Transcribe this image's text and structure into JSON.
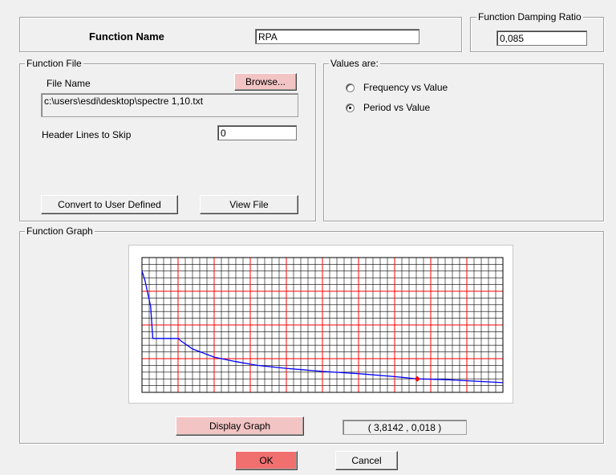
{
  "function_name": {
    "label": "Function Name",
    "value": "RPA"
  },
  "damping": {
    "legend": "Function Damping Ratio",
    "value": "0,085"
  },
  "function_file": {
    "legend": "Function File",
    "file_name_label": "File Name",
    "browse_label": "Browse...",
    "path": "c:\\users\\esdi\\desktop\\spectre 1,10.txt",
    "header_lines_label": "Header Lines to Skip",
    "header_lines_value": "0",
    "convert_label": "Convert to User Defined",
    "view_file_label": "View File"
  },
  "values_are": {
    "legend": "Values are:",
    "options": [
      {
        "label": "Frequency vs Value",
        "selected": false
      },
      {
        "label": "Period vs Value",
        "selected": true
      }
    ]
  },
  "function_graph": {
    "legend": "Function Graph",
    "display_label": "Display Graph",
    "coordinate_readout": "( 3,8142  ,  0,018 )"
  },
  "buttons": {
    "ok_label": "OK",
    "cancel_label": "Cancel"
  },
  "colors": {
    "grid_major": "#ff0000",
    "grid_minor": "#000000",
    "curve": "#0000ff",
    "marker": "#ff0000",
    "ok_button": "#f07070",
    "pink_button": "#f3c4c4"
  },
  "chart_data": {
    "type": "line",
    "title": "",
    "xlabel": "",
    "ylabel": "",
    "grid": true,
    "xlim": [
      0,
      5
    ],
    "ylim": [
      0,
      0.18
    ],
    "marked_point": {
      "x": 3.8142,
      "y": 0.018
    },
    "series": [
      {
        "x": [
          0,
          0.04,
          0.12,
          0.15,
          0.5,
          0.55,
          0.7,
          1.0,
          1.3,
          1.6,
          2.0,
          2.5,
          3.0,
          3.5,
          3.8142,
          4.2,
          4.6,
          5.0
        ],
        "y": [
          0.162,
          0.15,
          0.115,
          0.072,
          0.072,
          0.068,
          0.058,
          0.047,
          0.041,
          0.036,
          0.032,
          0.028,
          0.025,
          0.021,
          0.018,
          0.017,
          0.015,
          0.013
        ]
      }
    ]
  }
}
